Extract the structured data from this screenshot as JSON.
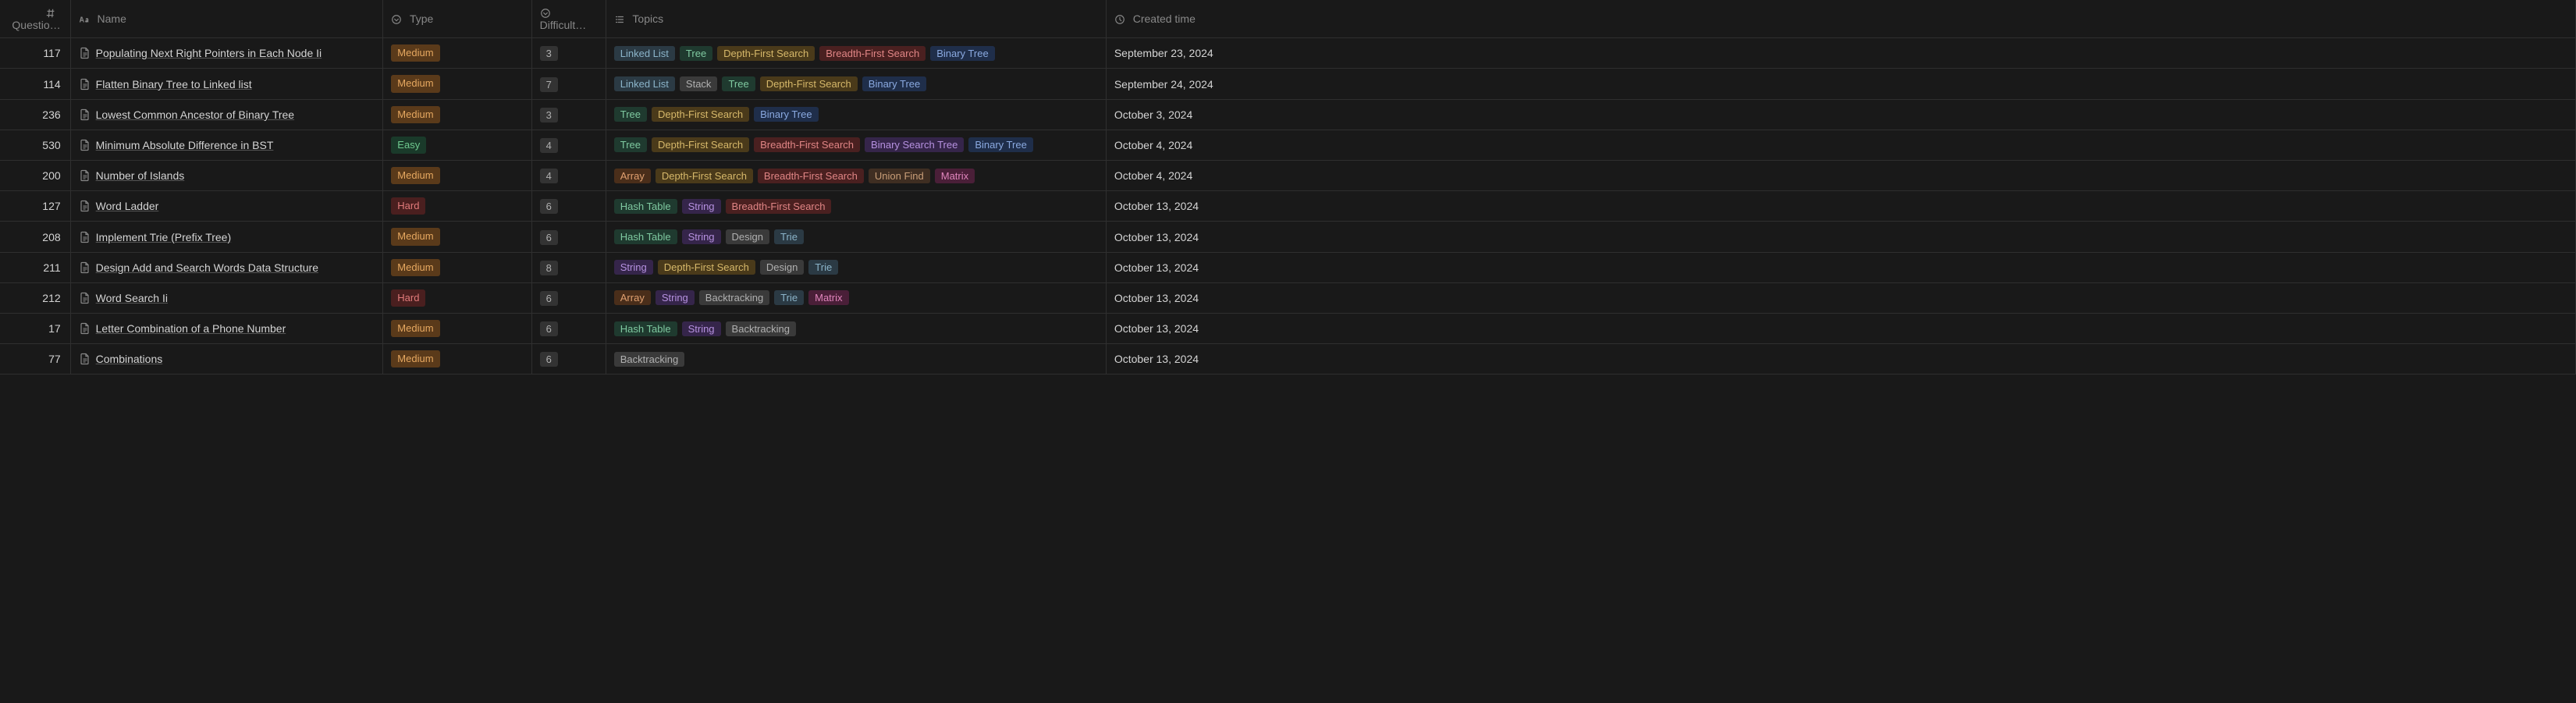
{
  "headers": {
    "question": "Questio…",
    "name": "Name",
    "type": "Type",
    "difficulty": "Difficult…",
    "topics": "Topics",
    "created": "Created time"
  },
  "tag_colors": {
    "Linked List": "tag-default",
    "Tree": "tag-green",
    "Depth-First Search": "tag-yellow",
    "Breadth-First Search": "tag-red",
    "Binary Tree": "tag-blue",
    "Stack": "tag-gray",
    "Binary Search Tree": "tag-purple",
    "Array": "tag-orange",
    "Union Find": "tag-brown",
    "Matrix": "tag-pink",
    "Hash Table": "tag-green",
    "String": "tag-purple",
    "Design": "tag-gray",
    "Trie": "tag-default",
    "Backtracking": "tag-gray"
  },
  "rows": [
    {
      "q": "117",
      "name": "Populating Next Right Pointers in Each Node Ii",
      "type": "Medium",
      "difficulty": "3",
      "topics": [
        "Linked List",
        "Tree",
        "Depth-First Search",
        "Breadth-First Search",
        "Binary Tree"
      ],
      "created": "September 23, 2024"
    },
    {
      "q": "114",
      "name": "Flatten Binary Tree to Linked list",
      "type": "Medium",
      "difficulty": "7",
      "topics": [
        "Linked List",
        "Stack",
        "Tree",
        "Depth-First Search",
        "Binary Tree"
      ],
      "created": "September 24, 2024"
    },
    {
      "q": "236",
      "name": "Lowest Common Ancestor of Binary Tree",
      "type": "Medium",
      "difficulty": "3",
      "topics": [
        "Tree",
        "Depth-First Search",
        "Binary Tree"
      ],
      "created": "October 3, 2024"
    },
    {
      "q": "530",
      "name": "Minimum Absolute Difference in BST",
      "type": "Easy",
      "difficulty": "4",
      "topics": [
        "Tree",
        "Depth-First Search",
        "Breadth-First Search",
        "Binary Search Tree",
        "Binary Tree"
      ],
      "created": "October 4, 2024"
    },
    {
      "q": "200",
      "name": "Number of Islands",
      "type": "Medium",
      "difficulty": "4",
      "topics": [
        "Array",
        "Depth-First Search",
        "Breadth-First Search",
        "Union Find",
        "Matrix"
      ],
      "created": "October 4, 2024"
    },
    {
      "q": "127",
      "name": "Word Ladder",
      "type": "Hard",
      "difficulty": "6",
      "topics": [
        "Hash Table",
        "String",
        "Breadth-First Search"
      ],
      "created": "October 13, 2024"
    },
    {
      "q": "208",
      "name": "Implement Trie (Prefix Tree)",
      "type": "Medium",
      "difficulty": "6",
      "topics": [
        "Hash Table",
        "String",
        "Design",
        "Trie"
      ],
      "created": "October 13, 2024"
    },
    {
      "q": "211",
      "name": "Design Add and Search Words Data Structure",
      "type": "Medium",
      "difficulty": "8",
      "topics": [
        "String",
        "Depth-First Search",
        "Design",
        "Trie"
      ],
      "created": "October 13, 2024"
    },
    {
      "q": "212",
      "name": "Word Search Ii",
      "type": "Hard",
      "difficulty": "6",
      "topics": [
        "Array",
        "String",
        "Backtracking",
        "Trie",
        "Matrix"
      ],
      "created": "October 13, 2024"
    },
    {
      "q": "17",
      "name": "Letter Combination of a Phone Number",
      "type": "Medium",
      "difficulty": "6",
      "topics": [
        "Hash Table",
        "String",
        "Backtracking"
      ],
      "created": "October 13, 2024"
    },
    {
      "q": "77",
      "name": "Combinations",
      "type": "Medium",
      "difficulty": "6",
      "topics": [
        "Backtracking"
      ],
      "created": "October 13, 2024"
    }
  ]
}
